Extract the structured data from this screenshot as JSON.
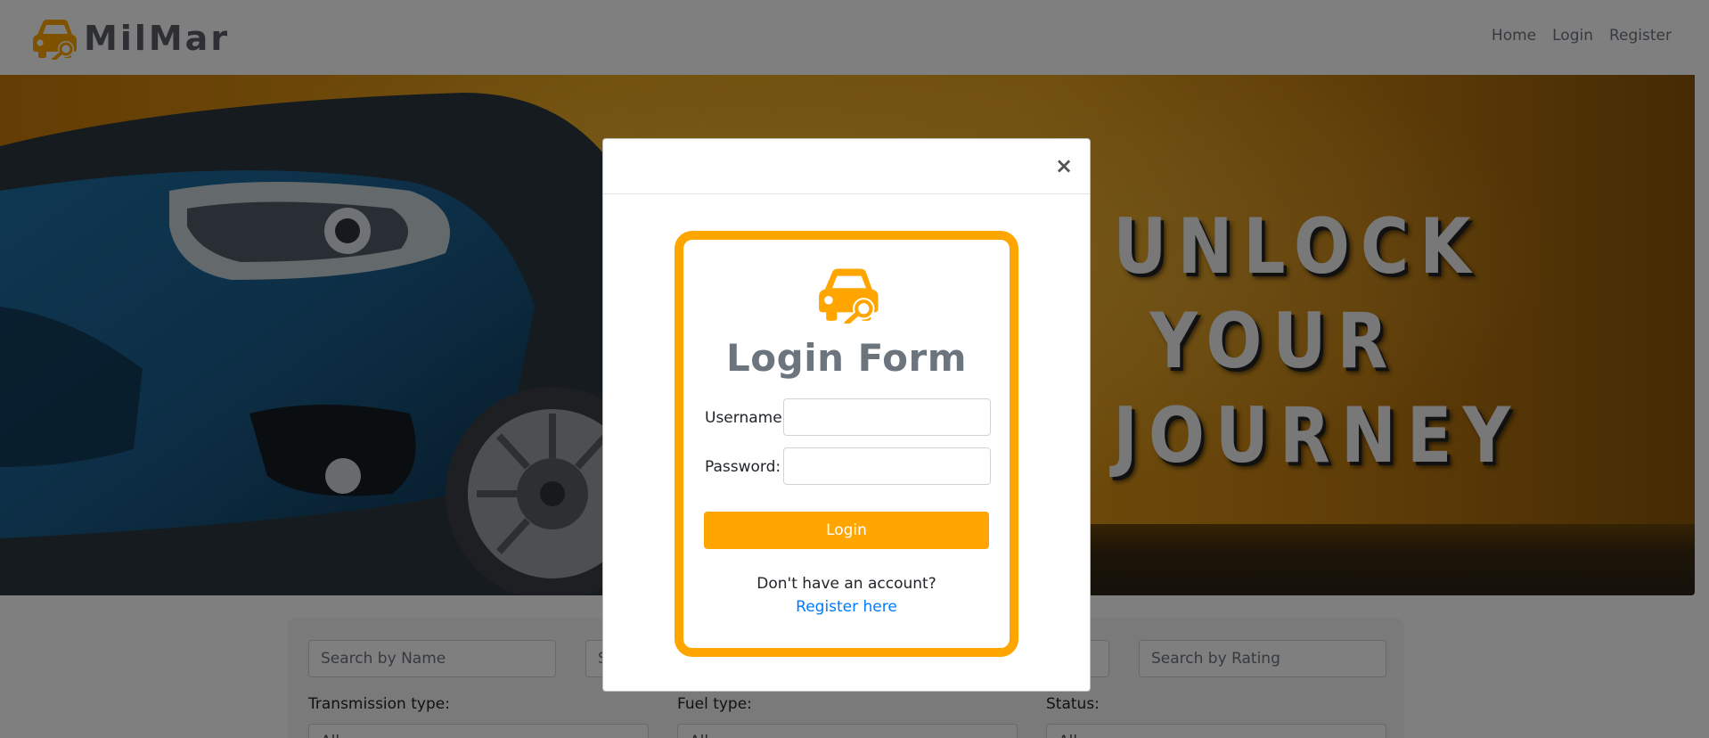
{
  "brand": {
    "name": "MilMar",
    "icon": "car-key-icon",
    "color": "#ffa500"
  },
  "nav": {
    "links": [
      {
        "label": "Home"
      },
      {
        "label": "Login"
      },
      {
        "label": "Register"
      }
    ]
  },
  "hero": {
    "lines": [
      "UNLOCK",
      "YOUR",
      "JOURNEY"
    ]
  },
  "search": {
    "name_placeholder": "Search by Name",
    "second_placeholder_partial": "S",
    "rating_placeholder": "Search by Rating",
    "filters": [
      {
        "label": "Transmission type:",
        "value": "All"
      },
      {
        "label": "Fuel type:",
        "value": "All"
      },
      {
        "label": "Status:",
        "value": "All"
      }
    ]
  },
  "modal": {
    "close_symbol": "×",
    "title": "Login Form",
    "icon": "car-key-icon",
    "username_label": "Username:",
    "password_label": "Password:",
    "username_value": "",
    "password_value": "",
    "login_button": "Login",
    "no_account_text": "Don't have an account?",
    "register_link": "Register here",
    "accent_color": "#ffa500",
    "link_color": "#007bff"
  }
}
